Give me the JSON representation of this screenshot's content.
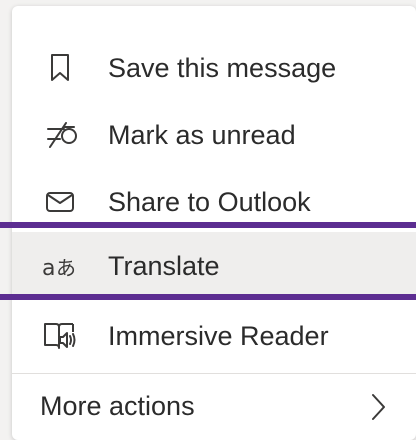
{
  "menu": {
    "items": [
      {
        "label": "Save this message",
        "icon": "bookmark-icon"
      },
      {
        "label": "Mark as unread",
        "icon": "mark-unread-icon"
      },
      {
        "label": "Share to Outlook",
        "icon": "envelope-icon"
      },
      {
        "label": "Translate",
        "icon": "translate-icon"
      },
      {
        "label": "Immersive Reader",
        "icon": "immersive-reader-icon"
      }
    ],
    "more": {
      "label": "More actions",
      "icon": "chevron-right-icon"
    }
  },
  "colors": {
    "highlight_line": "#5c2d91",
    "highlight_background": "#efeeed",
    "text": "#2b2b2b",
    "icon": "#3b3a39"
  }
}
